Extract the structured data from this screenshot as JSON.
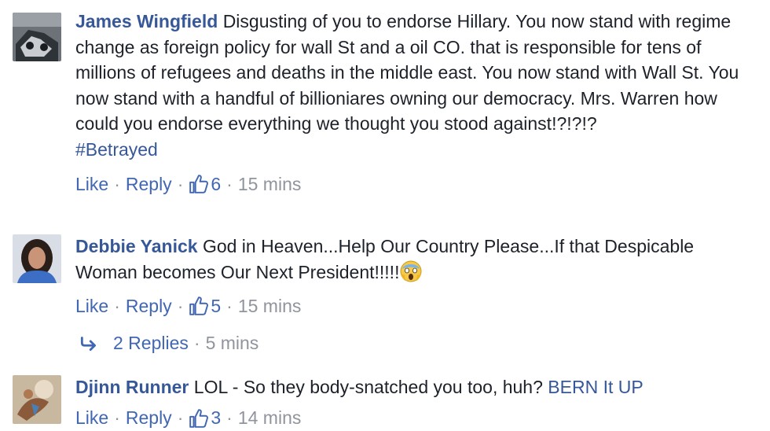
{
  "comments": [
    {
      "author": "James Wingfield",
      "text": "Disgusting of you to endorse Hillary. You now stand with regime change as foreign policy for wall St and a oil CO. that is responsible for tens of millions of refugees and deaths in the middle east. You now stand with Wall St. You now stand with a handful of billioniares owning our democracy. Mrs. Warren how could you endorse everything we thought you stood against!?!?!?",
      "hashtag": "#Betrayed",
      "like_label": "Like",
      "reply_label": "Reply",
      "likes": "6",
      "time": "15 mins"
    },
    {
      "author": "Debbie Yanick",
      "text": "God in Heaven...Help Our Country Please...If that Despicable Woman becomes Our Next President!!!!!",
      "emoji": "screaming-face-emoji",
      "like_label": "Like",
      "reply_label": "Reply",
      "likes": "5",
      "time": "15 mins",
      "replies_label": "2 Replies",
      "replies_time": "5 mins"
    },
    {
      "author": "Djinn Runner",
      "text": "LOL - So they body-snatched you too, huh?",
      "link_text": "BERN It UP",
      "like_label": "Like",
      "reply_label": "Reply",
      "likes": "3",
      "time": "14 mins"
    }
  ],
  "separator": "·",
  "colors": {
    "link": "#365899",
    "action": "#4267b2",
    "meta": "#90949c",
    "text": "#1d2129"
  }
}
